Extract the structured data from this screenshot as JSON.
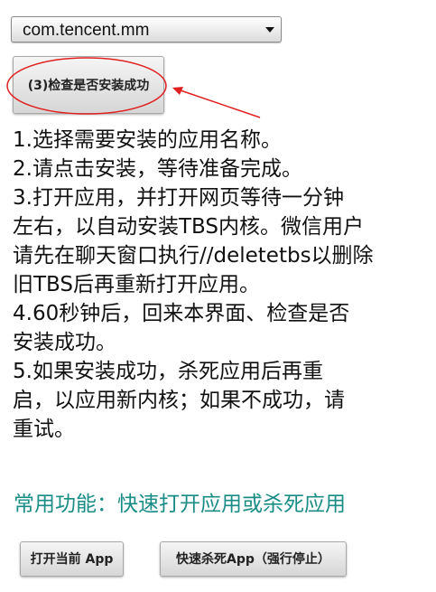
{
  "package_select": {
    "selected": "com.tencent.mm"
  },
  "check_button": {
    "label": "(3)检查是否安装成功"
  },
  "instructions": [
    " 1.选择需要安装的应用名称。",
    " 2.请点击安装，等待准备完成。",
    " 3.打开应用，并打开网页等待一分钟",
    "左右，以自动安装TBS内核。微信用户",
    "请先在聊天窗口执行//deletetbs以删除",
    "旧TBS后再重新打开应用。",
    " 4.60秒钟后，回来本界面、检查是否",
    "安装成功。",
    " 5.如果安装成功，杀死应用后再重",
    "启，以应用新内核；如果不成功，请",
    "重试。"
  ],
  "common_functions": {
    "title": "常用功能：快速打开应用或杀死应用",
    "open_app_label": "打开当前 App",
    "kill_app_label": "快速杀死App（强行停止）"
  },
  "colors": {
    "section_title": "#1a8c86",
    "annotation": "#e02020"
  }
}
